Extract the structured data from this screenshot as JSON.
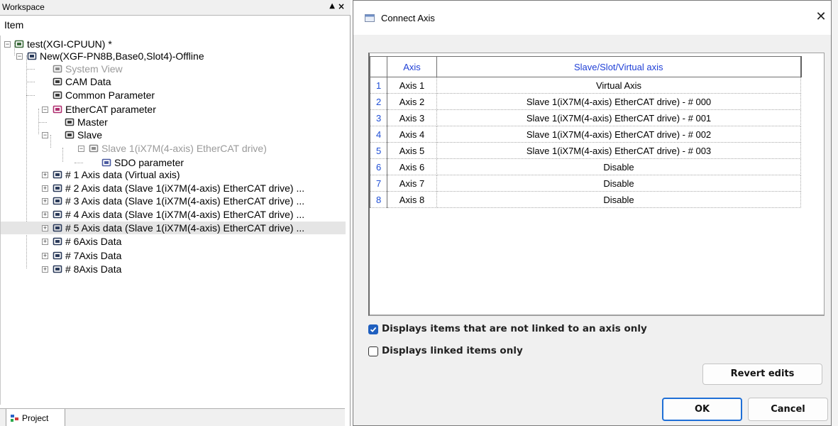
{
  "workspace": {
    "title": "Workspace",
    "item_header": "Item",
    "tree": [
      {
        "label": "test(XGI-CPUUN) *",
        "icon": "plc-cpu-icon",
        "expander": "−",
        "dim": false
      },
      {
        "label": "New(XGF-PN8B,Base0,Slot4)-Offline",
        "icon": "module-icon",
        "expander": "−",
        "dim": false
      },
      {
        "label": "System View",
        "icon": "system-view-icon",
        "expander": "",
        "dim": true
      },
      {
        "label": "CAM Data",
        "icon": "cam-icon",
        "expander": "",
        "dim": false
      },
      {
        "label": "Common Parameter",
        "icon": "parameter-icon",
        "expander": "",
        "dim": false
      },
      {
        "label": "EtherCAT parameter",
        "icon": "ethercat-icon",
        "expander": "−",
        "dim": false
      },
      {
        "label": "Master",
        "icon": "master-icon",
        "expander": "",
        "dim": false
      },
      {
        "label": "Slave",
        "icon": "slave-icon",
        "expander": "−",
        "dim": false
      },
      {
        "label": "Slave  1(iX7M(4-axis) EtherCAT drive)",
        "icon": "drive-icon",
        "expander": "−",
        "dim": true
      },
      {
        "label": "SDO parameter",
        "icon": "sdo-icon",
        "expander": "",
        "dim": false
      },
      {
        "label": "# 1 Axis data (Virtual axis)",
        "icon": "axis-data-icon",
        "expander": "+",
        "dim": false
      },
      {
        "label": "# 2 Axis data (Slave 1(iX7M(4-axis) EtherCAT drive) ...",
        "icon": "axis-data-icon",
        "expander": "+",
        "dim": false
      },
      {
        "label": "# 3 Axis data (Slave 1(iX7M(4-axis) EtherCAT drive) ...",
        "icon": "axis-data-icon",
        "expander": "+",
        "dim": false
      },
      {
        "label": "# 4 Axis data (Slave 1(iX7M(4-axis) EtherCAT drive) ...",
        "icon": "axis-data-icon",
        "expander": "+",
        "dim": false
      },
      {
        "label": "# 5 Axis data (Slave 1(iX7M(4-axis) EtherCAT drive) ...",
        "icon": "axis-data-icon",
        "expander": "+",
        "dim": false,
        "selected": true
      },
      {
        "label": "# 6Axis Data",
        "icon": "axis-data-icon",
        "expander": "+",
        "dim": false
      },
      {
        "label": "# 7Axis Data",
        "icon": "axis-data-icon",
        "expander": "+",
        "dim": false
      },
      {
        "label": "# 8Axis Data",
        "icon": "axis-data-icon",
        "expander": "+",
        "dim": false
      }
    ],
    "project_tab": "Project"
  },
  "dialog": {
    "title": "Connect Axis",
    "close_glyph": "✕",
    "table": {
      "headers": [
        "Axis",
        "Slave/Slot/Virtual axis"
      ],
      "rows": [
        {
          "num": "1",
          "axis": "Axis 1",
          "target": "Virtual Axis"
        },
        {
          "num": "2",
          "axis": "Axis 2",
          "target": "Slave 1(iX7M(4-axis) EtherCAT drive) - # 000"
        },
        {
          "num": "3",
          "axis": "Axis 3",
          "target": "Slave 1(iX7M(4-axis) EtherCAT drive) - # 001"
        },
        {
          "num": "4",
          "axis": "Axis 4",
          "target": "Slave 1(iX7M(4-axis) EtherCAT drive) - # 002"
        },
        {
          "num": "5",
          "axis": "Axis 5",
          "target": "Slave 1(iX7M(4-axis) EtherCAT drive) - # 003"
        },
        {
          "num": "6",
          "axis": "Axis 6",
          "target": "Disable"
        },
        {
          "num": "7",
          "axis": "Axis 7",
          "target": "Disable"
        },
        {
          "num": "8",
          "axis": "Axis 8",
          "target": "Disable"
        }
      ]
    },
    "checkboxes": [
      {
        "label": "Displays items that are not linked to an axis only",
        "checked": true
      },
      {
        "label": "Displays linked items only",
        "checked": false
      }
    ],
    "buttons": {
      "revert": "Revert edits",
      "ok": "OK",
      "cancel": "Cancel"
    },
    "colors": {
      "accent": "#1f6fd6",
      "header_text": "#1f3fd6",
      "checkbox_on": "#1f5fbf"
    }
  }
}
